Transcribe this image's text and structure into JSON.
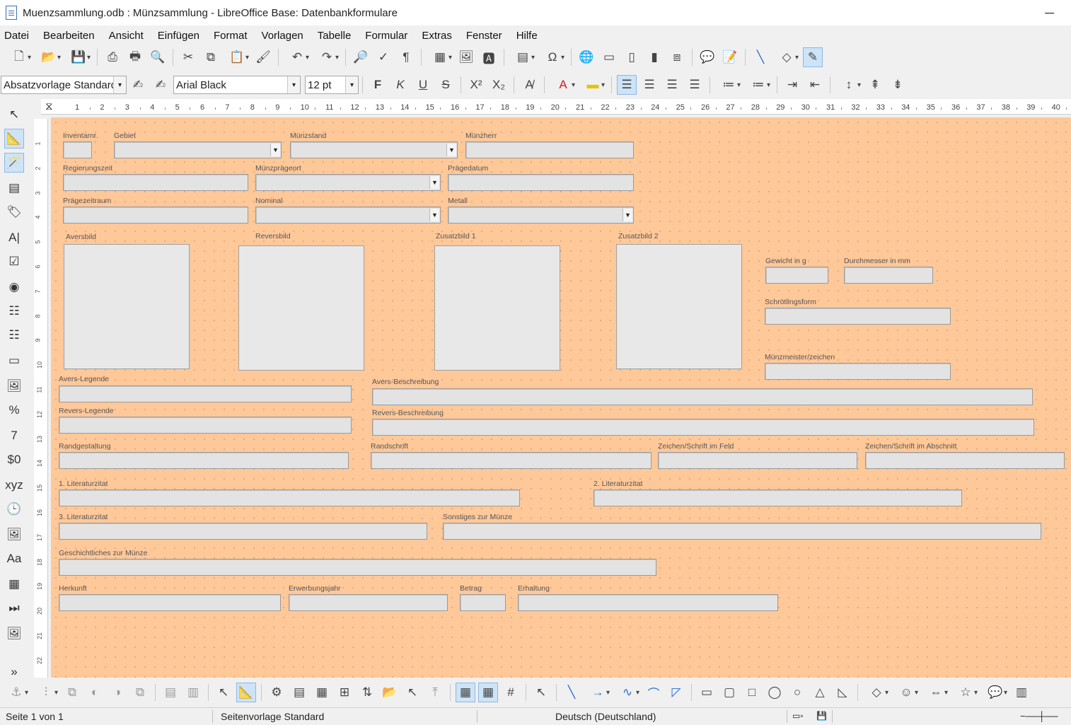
{
  "window": {
    "title": "Muenzsammlung.odb : Münzsammlung - LibreOffice Base: Datenbankformulare",
    "minimize_glyph": "─"
  },
  "menu": [
    "Datei",
    "Bearbeiten",
    "Ansicht",
    "Einfügen",
    "Format",
    "Vorlagen",
    "Tabelle",
    "Formular",
    "Extras",
    "Fenster",
    "Hilfe"
  ],
  "format_bar": {
    "paragraph_style": "Absatzvorlage Standard",
    "font_name": "Arial Black",
    "font_size": "12 pt"
  },
  "ruler_numbers": [
    "1",
    "2",
    "3",
    "4",
    "5",
    "6",
    "7",
    "8",
    "9",
    "10",
    "11",
    "12",
    "13",
    "14",
    "15",
    "16",
    "17",
    "18",
    "19",
    "20",
    "21",
    "22",
    "23",
    "24",
    "25",
    "26",
    "27",
    "28",
    "29",
    "30",
    "31",
    "32",
    "33",
    "34",
    "35",
    "36",
    "37",
    "38",
    "39",
    "40"
  ],
  "vruler_numbers": [
    "1",
    "2",
    "3",
    "4",
    "5",
    "6",
    "7",
    "8",
    "9",
    "10",
    "11",
    "12",
    "13",
    "14",
    "15",
    "16",
    "17",
    "18",
    "19",
    "20",
    "21",
    "22"
  ],
  "form": {
    "inventarnr": "Inventarnr.",
    "gebiet": "Gebiet",
    "muenzstand": "Münzstand",
    "muenzherr": "Münzherr",
    "regierungszeit": "Regierungszeit",
    "muenzpraegeort": "Münzprägeort",
    "praegedatum": "Prägedatum",
    "praegezeitraum": "Prägezeitraum",
    "nominal": "Nominal",
    "metall": "Metall",
    "aversbild": "Aversbild",
    "reversbild": "Reversbild",
    "zusatzbild1": "Zusatzbild 1",
    "zusatzbild2": "Zusatzbild 2",
    "gewicht": "Gewicht in g",
    "durchmesser": "Durchmesser in mm",
    "schroetlingsform": "Schrötlingsform",
    "muenzmeister": "Münzmeister/zeichen",
    "avers_legende": "Avers-Legende",
    "avers_beschreibung": "Avers-Beschreibung",
    "revers_legende": "Revers-Legende",
    "revers_beschreibung": "Revers-Beschreibung",
    "randgestaltung": "Randgestaltung",
    "randschrift": "Randschrift",
    "zeichen_feld": "Zeichen/Schrift im Feld",
    "zeichen_abschnitt": "Zeichen/Schrift im Abschnitt",
    "literatur1": "1. Literaturzitat",
    "literatur2": "2. Literaturzitat",
    "literatur3": "3. Literaturzitat",
    "sonstiges": "Sonstiges zur Münze",
    "geschichtliches": "Geschichtliches zur Münze",
    "herkunft": "Herkunft",
    "erwerbungsjahr": "Erwerbungsjahr",
    "betrag": "Betrag",
    "erhaltung": "Erhaltung"
  },
  "status": {
    "page": "Seite 1 von 1",
    "page_style": "Seitenvorlage Standard",
    "language": "Deutsch (Deutschland)"
  },
  "colors": {
    "canvas": "#ffc899",
    "field": "#e3e3e3",
    "accent": "#cde3f7"
  }
}
